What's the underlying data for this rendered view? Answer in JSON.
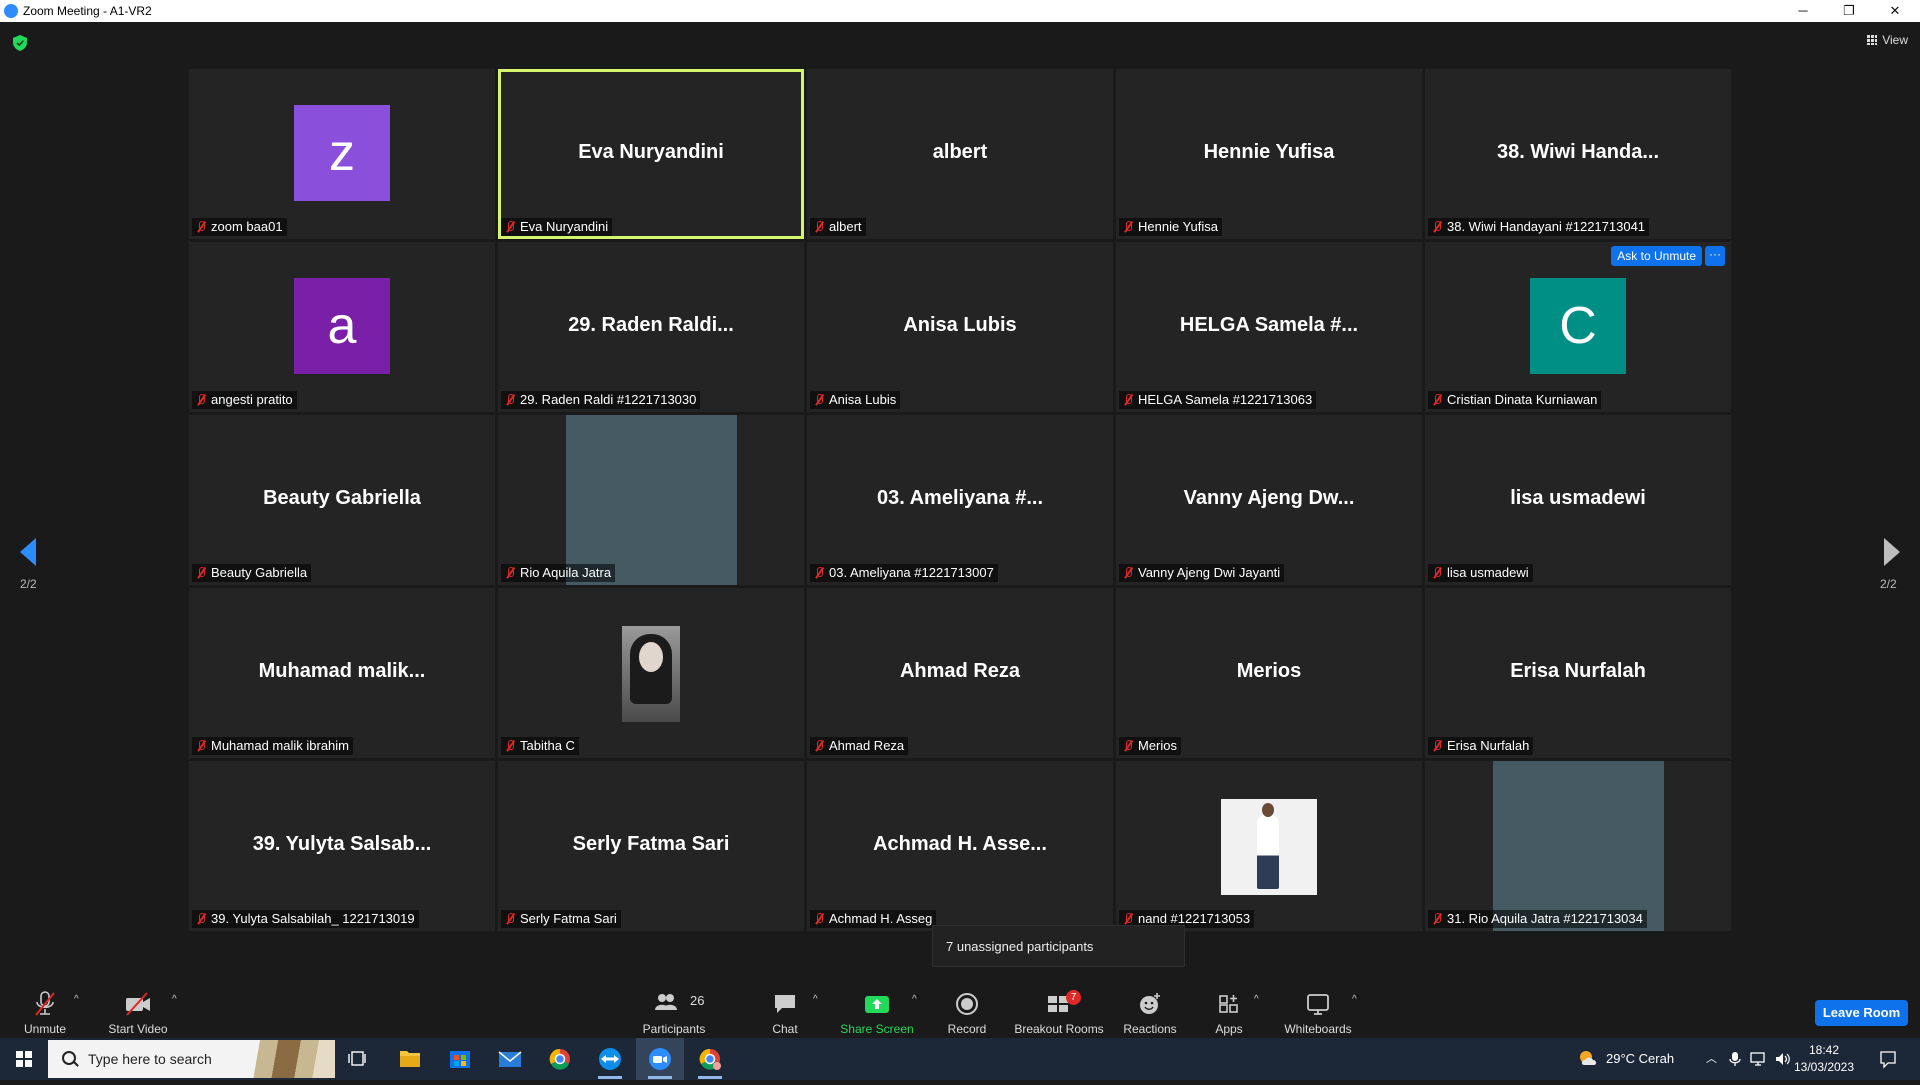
{
  "window": {
    "title": "Zoom Meeting - A1-VR2",
    "minimize": "─",
    "restore": "❐",
    "close": "✕"
  },
  "view_button": {
    "label": "View"
  },
  "tiles": [
    {
      "big": "",
      "avatar_letter": "z",
      "avatar_color": "#8a4fdb",
      "label": "zoom baa01"
    },
    {
      "big": "Eva Nuryandini",
      "label": "Eva Nuryandini",
      "active": true
    },
    {
      "big": "albert",
      "label": "albert"
    },
    {
      "big": "Hennie Yufisa",
      "label": "Hennie Yufisa"
    },
    {
      "big": "38. Wiwi Handa...",
      "label": "38. Wiwi Handayani #1221713041"
    },
    {
      "big": "",
      "avatar_letter": "a",
      "avatar_color": "#7a1fa8",
      "label": "angesti pratito"
    },
    {
      "big": "29. Raden Raldi...",
      "label": "29. Raden Raldi #1221713030"
    },
    {
      "big": "Anisa Lubis",
      "label": "Anisa Lubis"
    },
    {
      "big": "HELGA Samela #...",
      "label": "HELGA Samela #1221713063"
    },
    {
      "big": "",
      "avatar_letter": "C",
      "avatar_color": "#008f84",
      "label": "Cristian Dinata Kurniawan",
      "ask_to_unmute": "Ask to Unmute",
      "more": "···"
    },
    {
      "big": "Beauty Gabriella",
      "label": "Beauty Gabriella"
    },
    {
      "big": "",
      "video": true,
      "label": "Rio Aquila Jatra"
    },
    {
      "big": "03. Ameliyana #...",
      "label": "03. Ameliyana #1221713007"
    },
    {
      "big": "Vanny Ajeng Dw...",
      "label": "Vanny Ajeng Dwi Jayanti"
    },
    {
      "big": "lisa usmadewi",
      "label": "lisa usmadewi"
    },
    {
      "big": "Muhamad  malik...",
      "label": "Muhamad malik ibrahim"
    },
    {
      "big": "",
      "photo": "woman",
      "label": "Tabitha C"
    },
    {
      "big": "Ahmad Reza",
      "label": "Ahmad Reza"
    },
    {
      "big": "Merios",
      "label": "Merios"
    },
    {
      "big": "Erisa Nurfalah",
      "label": "Erisa Nurfalah"
    },
    {
      "big": "39. Yulyta Salsab...",
      "label": "39. Yulyta Salsabilah_ 1221713019"
    },
    {
      "big": "Serly Fatma Sari",
      "label": "Serly Fatma Sari"
    },
    {
      "big": "Achmad H. Asse...",
      "label": "Achmad H. Asseg"
    },
    {
      "big": "",
      "photo": "man",
      "label": "nand #1221713053"
    },
    {
      "big": "",
      "video": true,
      "label": "31. Rio Aquila Jatra #1221713034"
    }
  ],
  "pager": {
    "left": "2/2",
    "right": "2/2"
  },
  "popup": {
    "text": "7 unassigned participants"
  },
  "toolbar": {
    "unmute": "Unmute",
    "start_video": "Start Video",
    "participants": "Participants",
    "participants_count": "26",
    "chat": "Chat",
    "share_screen": "Share Screen",
    "record": "Record",
    "breakout_rooms": "Breakout Rooms",
    "breakout_badge": "7",
    "reactions": "Reactions",
    "apps": "Apps",
    "whiteboards": "Whiteboards",
    "leave": "Leave Room",
    "caret": "^"
  },
  "taskbar": {
    "search_placeholder": "Type here to search",
    "weather": "29°C  Cerah",
    "time": "18:42",
    "date": "13/03/2023"
  },
  "colors": {
    "accent": "#0e72ed",
    "active_border": "#d6f56e",
    "share_green": "#23d959",
    "badge_red": "#e02828"
  }
}
